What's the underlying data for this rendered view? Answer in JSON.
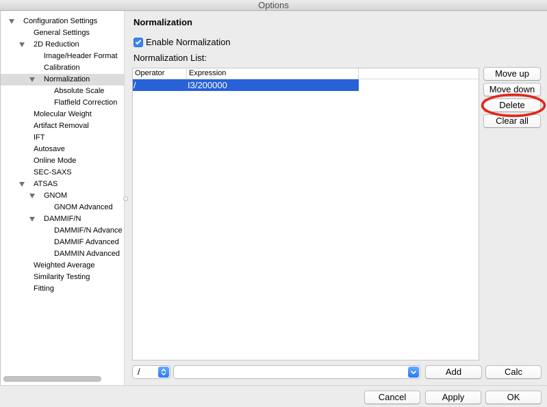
{
  "window": {
    "title": "Options"
  },
  "sidebar": {
    "items": [
      {
        "label": "Configuration Settings",
        "expanded": true
      },
      {
        "label": "General Settings"
      },
      {
        "label": "2D Reduction",
        "expanded": true
      },
      {
        "label": "Image/Header Format"
      },
      {
        "label": "Calibration"
      },
      {
        "label": "Normalization",
        "expanded": true,
        "selected": true
      },
      {
        "label": "Absolute Scale"
      },
      {
        "label": "Flatfield Correction"
      },
      {
        "label": "Molecular Weight"
      },
      {
        "label": "Artifact Removal"
      },
      {
        "label": "IFT"
      },
      {
        "label": "Autosave"
      },
      {
        "label": "Online Mode"
      },
      {
        "label": "SEC-SAXS"
      },
      {
        "label": "ATSAS",
        "expanded": true
      },
      {
        "label": "GNOM",
        "expanded": true
      },
      {
        "label": "GNOM Advanced"
      },
      {
        "label": "DAMMIF/N",
        "expanded": true
      },
      {
        "label": "DAMMIF/N Advance"
      },
      {
        "label": "DAMMIF Advanced"
      },
      {
        "label": "DAMMIN Advanced"
      },
      {
        "label": "Weighted Average"
      },
      {
        "label": "Similarity Testing"
      },
      {
        "label": "Fitting"
      }
    ]
  },
  "panel": {
    "title": "Normalization",
    "enable_checkbox": {
      "label": "Enable Normalization",
      "checked": true
    },
    "list_label": "Normalization List:",
    "table": {
      "columns": [
        "Operator",
        "Expression"
      ],
      "rows": [
        {
          "operator": "/",
          "expression": "I3/200000",
          "selected": true
        }
      ]
    },
    "buttons": {
      "move_up": "Move up",
      "move_down": "Move down",
      "delete": "Delete",
      "clear_all": "Clear all"
    },
    "entry": {
      "operator_value": "/",
      "expression_value": "",
      "add": "Add",
      "calc": "Calc"
    }
  },
  "footer": {
    "cancel": "Cancel",
    "apply": "Apply",
    "ok": "OK"
  },
  "icons": {
    "tree_toggle": "triangle-down-icon",
    "checkbox": "checkmark-icon",
    "operator_popup": "updown-chevron-icon",
    "combo_dropdown": "chevron-down-icon"
  },
  "colors": {
    "accent": "#3b82f7",
    "row_selection": "#2861d8",
    "tree_selection": "#dcdcdc",
    "annotation": "#e3261c"
  }
}
